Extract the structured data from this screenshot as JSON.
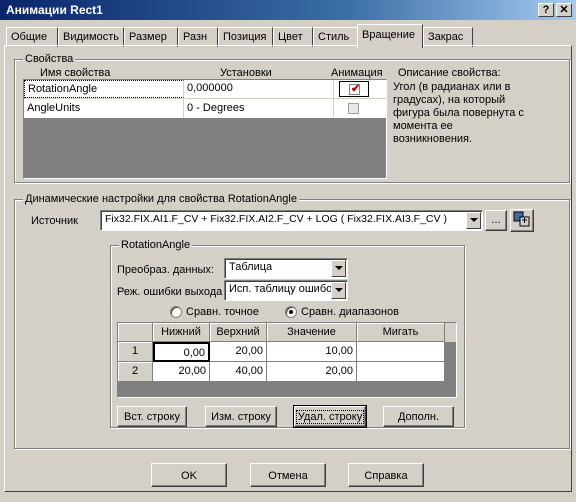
{
  "window": {
    "title": "Анимации Rect1",
    "help_glyph": "?",
    "close_glyph": "✕"
  },
  "tabs": [
    "Общие",
    "Видимость",
    "Размер",
    "Разн",
    "Позиция",
    "Цвет",
    "Стиль",
    "Вращение",
    "Закрас"
  ],
  "properties": {
    "group_label": "Свойства",
    "col_name": "Имя свойства",
    "col_settings": "Установки",
    "col_animation": "Анимация",
    "description_label": "Описание свойства:",
    "description_text": "Угол (в радианах или в градусах), на который фигура была повернута с момента ее возникновения.",
    "rows": [
      {
        "name": "RotationAngle",
        "value": "0,000000",
        "animated": true
      },
      {
        "name": "AngleUnits",
        "value": "0 - Degrees",
        "animated": false
      }
    ]
  },
  "dynamic": {
    "group_label": "Динамические настройки для  свойства RotationAngle",
    "source_label": "Источник",
    "source_value": "Fix32.FIX.AI1.F_CV + Fix32.FIX.AI2.F_CV + LOG ( Fix32.FIX.AI3.F_CV )",
    "browse_label": "..."
  },
  "rotation": {
    "group_label": "RotationAngle",
    "conversion_label": "Преобраз. данных:",
    "conversion_value": "Таблица",
    "error_label": "Реж. ошибки выхода",
    "error_value": "Исп. таблицу ошибок",
    "radio_exact": "Сравн. точное",
    "radio_range": "Сравн. диапазонов",
    "selected_mode": "range",
    "table": {
      "headers": [
        "Нижний",
        "Верхний",
        "Значение",
        "Мигать"
      ],
      "rows": [
        {
          "num": "1",
          "low": "0,00",
          "high": "20,00",
          "value": "10,00",
          "blink": ""
        },
        {
          "num": "2",
          "low": "20,00",
          "high": "40,00",
          "value": "20,00",
          "blink": ""
        }
      ]
    },
    "buttons": {
      "insert": "Вст. строку",
      "edit": "Изм. строку",
      "delete": "Удал. строку",
      "more": "Дополн."
    }
  },
  "footer": {
    "ok": "OK",
    "cancel": "Отмена",
    "help": "Справка"
  },
  "colors": {
    "title_start": "#0a246a",
    "title_end": "#a6caf0",
    "face": "#d4d0c8",
    "checkmark": "#c00000"
  }
}
